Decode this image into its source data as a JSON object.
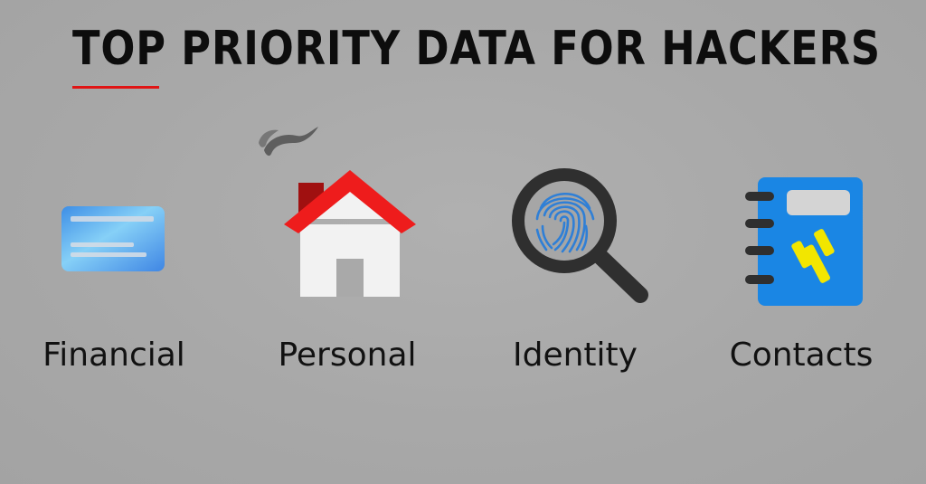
{
  "title": "TOP PRIORITY DATA FOR HACKERS",
  "colors": {
    "background": "#a9a9a9",
    "title_text": "#0d0d0d",
    "underline_accent": "#e01515",
    "roof_red": "#ee1c1c",
    "chimney_dark_red": "#a01010",
    "house_white": "#f2f2f2",
    "magnifier_dark": "#2f2f2f",
    "fingerprint_blue": "#2f7fd6",
    "book_blue": "#1a86e4",
    "phone_yellow": "#f2e600",
    "card_blue": "#5ab4f2"
  },
  "items": [
    {
      "label": "Financial",
      "icon": "credit-card-icon"
    },
    {
      "label": "Personal",
      "icon": "house-icon"
    },
    {
      "label": "Identity",
      "icon": "fingerprint-magnifier-icon"
    },
    {
      "label": "Contacts",
      "icon": "address-book-icon"
    }
  ]
}
